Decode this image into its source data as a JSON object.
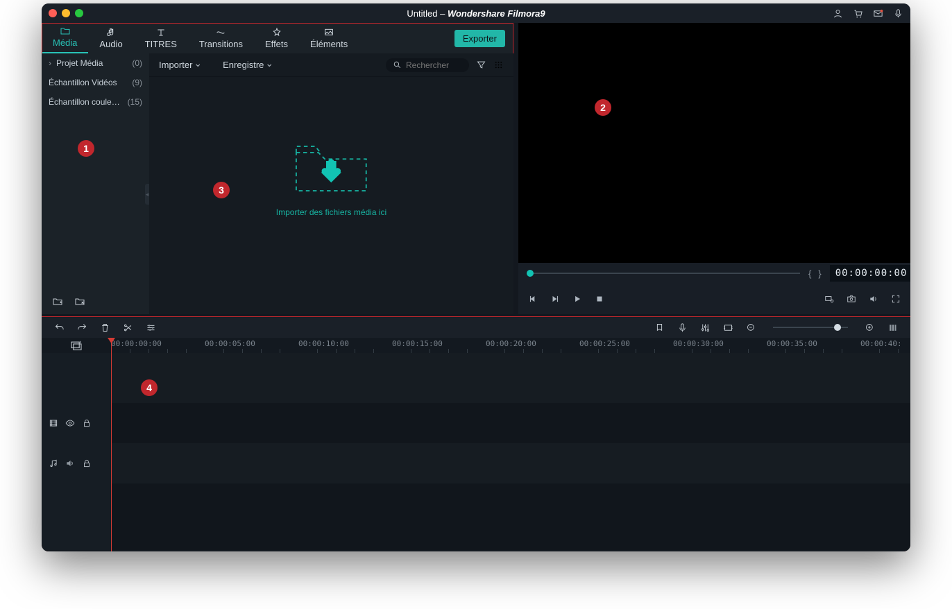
{
  "window": {
    "title_doc": "Untitled",
    "title_app": "Wondershare Filmora9"
  },
  "tabs": [
    {
      "label": "Média",
      "active": true
    },
    {
      "label": "Audio"
    },
    {
      "label": "TITRES"
    },
    {
      "label": "Transitions"
    },
    {
      "label": "Effets"
    },
    {
      "label": "Éléments"
    }
  ],
  "export_button": "Exporter",
  "sidebar": {
    "items": [
      {
        "label": "Projet Média",
        "count": "(0)",
        "expandable": true
      },
      {
        "label": "Échantillon Vidéos",
        "count": "(9)"
      },
      {
        "label": "Échantillon coule…",
        "count": "(15)"
      }
    ]
  },
  "toolbar": {
    "import": "Importer",
    "record": "Enregistre",
    "search_placeholder": "Rechercher"
  },
  "dropzone": {
    "label": "Importer des fichiers média ici"
  },
  "preview": {
    "timecode": "00:00:00:00"
  },
  "timeline": {
    "ticks": [
      "00:00:00:00",
      "00:00:05:00",
      "00:00:10:00",
      "00:00:15:00",
      "00:00:20:00",
      "00:00:25:00",
      "00:00:30:00",
      "00:00:35:00",
      "00:00:40:"
    ]
  },
  "annotations": {
    "b1": "1",
    "b2": "2",
    "b3": "3",
    "b4": "4"
  }
}
